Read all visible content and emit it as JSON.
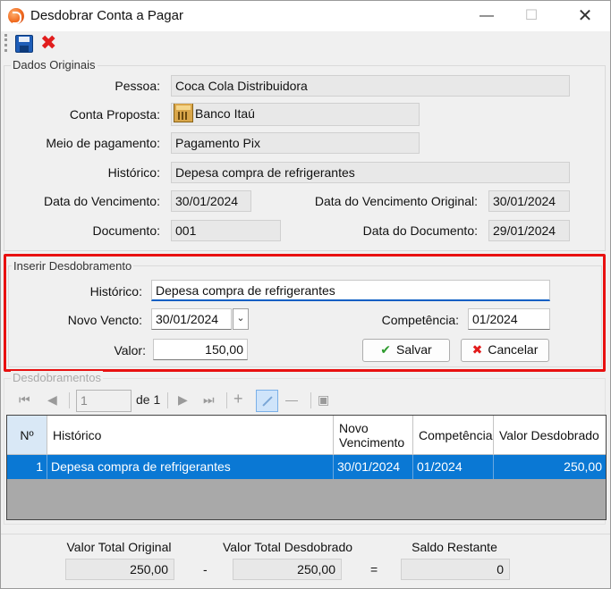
{
  "window": {
    "title": "Desdobrar Conta a Pagar",
    "minimize": "—",
    "maximize": "☐",
    "close": "✕"
  },
  "toolbar": {
    "save_label": "",
    "close_glyph": "✖"
  },
  "dados_originais": {
    "legend": "Dados Originais",
    "pessoa_label": "Pessoa:",
    "pessoa": "Coca Cola Distribuidora",
    "conta_label": "Conta Proposta:",
    "conta": "Banco Itaú",
    "meio_label": "Meio de pagamento:",
    "meio": "Pagamento Pix",
    "historico_label": "Histórico:",
    "historico": "Depesa compra de refrigerantes",
    "vencimento_label": "Data do Vencimento:",
    "vencimento": "30/01/2024",
    "venc_original_label": "Data do Vencimento Original:",
    "venc_original": "30/01/2024",
    "documento_label": "Documento:",
    "documento": "001",
    "data_documento_label": "Data do Documento:",
    "data_documento": "29/01/2024"
  },
  "inserir": {
    "legend": "Inserir Desdobramento",
    "historico_label": "Histórico:",
    "historico": "Depesa compra de refrigerantes",
    "novo_vencto_label": "Novo Vencto:",
    "novo_vencto": "30/01/2024",
    "competencia_label": "Competência:",
    "competencia": "01/2024",
    "valor_label": "Valor:",
    "valor": "150,00",
    "salvar": "Salvar",
    "cancelar": "Cancelar"
  },
  "desdobramentos": {
    "legend": "Desdobramentos",
    "nav": {
      "position": "1",
      "of": "de 1",
      "first": "⏮",
      "prev": "◀",
      "next": "▶",
      "last": "⏭",
      "add": "+",
      "delete": "—",
      "save": "▣"
    },
    "columns": [
      "Nº",
      "Histórico",
      "Novo Vencimento",
      "Competência",
      "Valor Desdobrado"
    ],
    "rows": [
      {
        "n": "1",
        "historico": "Depesa compra de refrigerantes",
        "vencimento": "30/01/2024",
        "competencia": "01/2024",
        "valor": "250,00"
      }
    ]
  },
  "footer": {
    "total_original_label": "Valor Total Original",
    "total_original": "250,00",
    "minus": "-",
    "total_desdobrado_label": "Valor Total Desdobrado",
    "total_desdobrado": "250,00",
    "equals": "=",
    "saldo_label": "Saldo Restante",
    "saldo": "0"
  },
  "colors": {
    "accent": "#0a78d4",
    "highlight_frame": "#e81010",
    "save_check": "#2e9b2e",
    "cancel_x": "#e21b1b"
  }
}
